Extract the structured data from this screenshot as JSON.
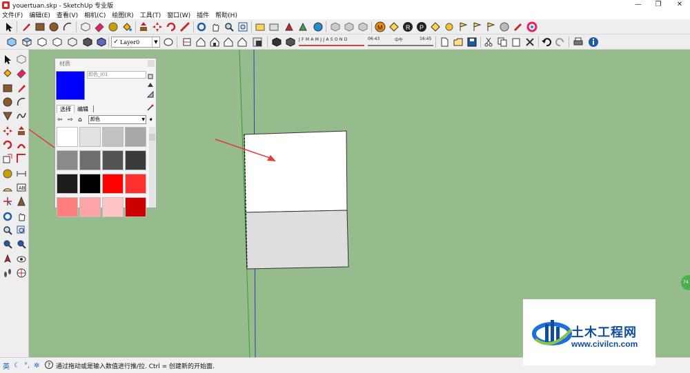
{
  "window": {
    "title": "youertuan.skp - SketchUp 专业版",
    "minimize": "—",
    "restore": "❐",
    "close": "✕"
  },
  "menu": [
    "文件(F)",
    "编辑(E)",
    "查看(V)",
    "相机(C)",
    "绘图(R)",
    "工具(T)",
    "窗口(W)",
    "插件",
    "帮助(H)"
  ],
  "layer_toolbar": {
    "check": "✓",
    "layer": "Layer0"
  },
  "shadow": {
    "months": "J F M A M J J A S O N D",
    "time_start": "06:43",
    "time_noon": "中午",
    "time_end": "16:45"
  },
  "materials_panel": {
    "title": "材质",
    "material_name": "颜色_I01",
    "tabs": [
      "选择",
      "编辑"
    ],
    "library": "颜色",
    "current_color": "#0000ff",
    "swatches": [
      "#ffffff",
      "#e2e2e2",
      "#c2c2c2",
      "#a8a8a8",
      "#8a8a8a",
      "#6e6e6e",
      "#545454",
      "#3a3a3a",
      "#1c1c1c",
      "#000000",
      "#ff0000",
      "#ff3030",
      "#ff7f7f",
      "#ffa4a4",
      "#ffc4c4",
      "#cc0000"
    ]
  },
  "statusbar": {
    "ime_lang": "英",
    "message": "通过拖动或是输入数值进行推/拉. Ctrl = 创建新的开始面."
  },
  "logo": {
    "name": "土木工程网",
    "url": "www.civilcn.com"
  },
  "edge_badge": "74"
}
